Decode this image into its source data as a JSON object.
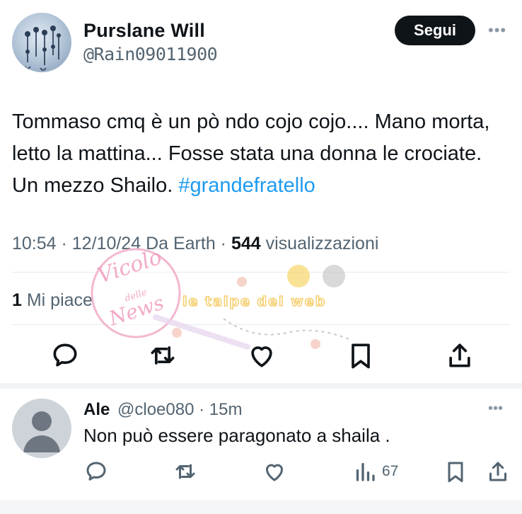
{
  "author": {
    "name": "Purslane Will",
    "handle": "@Rain09011900"
  },
  "follow_label": "Segui",
  "more_label": "•••",
  "tweet": {
    "text": "Tommaso cmq è un pò ndo cojo cojo.... Mano morta, letto la mattina... Fosse stata una donna le crociate. Un mezzo Shailo. ",
    "hashtag": "#grandefratello"
  },
  "meta": {
    "time": "10:54",
    "date": "12/10/24",
    "source": "Da Earth",
    "views_count": "544",
    "views_label": "visualizzazioni"
  },
  "likes": {
    "count": "1",
    "label": "Mi piace"
  },
  "reply": {
    "name": "Ale",
    "handle": "@cloe080",
    "age": "15m",
    "text": "Non può essere paragonato a shaila  .",
    "views": "67"
  },
  "watermark": {
    "stamp_line1": "Vicolo",
    "stamp_line2": "delle",
    "stamp_line3": "News",
    "banner": "le talpe del web"
  },
  "colors": {
    "accent": "#1d9bf0",
    "text": "#0f1419",
    "muted": "#536471",
    "button_bg": "#0f1419"
  }
}
